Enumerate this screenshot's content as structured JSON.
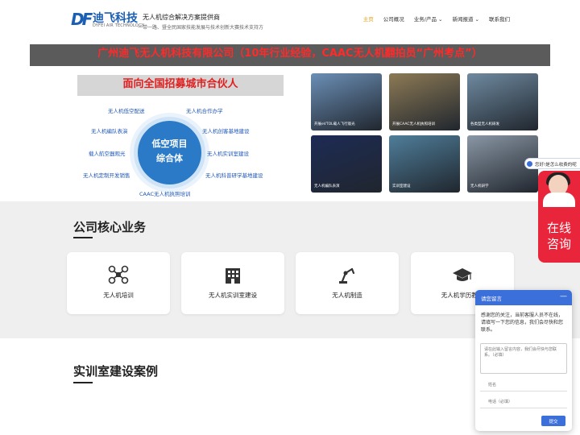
{
  "header": {
    "logo_mark": "DF",
    "logo_text": "迪飞科技",
    "logo_sub": "DYFEI AIR TECHNOLOGY",
    "slogan_title": "无人机综合解决方案提供商",
    "slogan_sub": "一带一路、暨全民国家技能发展与技术创新大赛技术支持方",
    "nav": [
      "主页",
      "公司概况",
      "业务/产品 ⌄",
      "新闻报道 ⌄",
      "联系我们"
    ]
  },
  "banner": {
    "text": "广州迪飞无人机科技有限公司（10年行业经验，CAAC无人机翻拍员“广州考点”）"
  },
  "partner": {
    "heading": "面向全国招募城市合伙人",
    "center_line1": "低空项目",
    "center_line2": "综合体",
    "tags": [
      "无人机低空配送",
      "无人机合作办学",
      "无人机编队表演",
      "无人机创客基地建设",
      "载人航空器观光",
      "无人机实训室建设",
      "无人机定制开发销售",
      "无人机科普研学基地建设",
      "CAAC无人机执照培训"
    ]
  },
  "photos": [
    {
      "caption": "开展eVTOL载人飞行观光",
      "color": "#6b8fb6"
    },
    {
      "caption": "开展CAAC无人机执照培训",
      "color": "#8d7a55"
    },
    {
      "caption": "各类型无人机研发",
      "color": "#6f8aa0"
    },
    {
      "caption": "无人机编队表演",
      "color": "#1d2b55"
    },
    {
      "caption": "实训室建设",
      "color": "#4f7e9a"
    },
    {
      "caption": "无人机研学",
      "color": "#8a97a5"
    }
  ],
  "services": {
    "title": "公司核心业务",
    "cards": [
      {
        "label": "无人机培训",
        "icon": "drone-icon"
      },
      {
        "label": "无人机实训室建设",
        "icon": "building-icon"
      },
      {
        "label": "无人机制造",
        "icon": "robot-arm-icon"
      },
      {
        "label": "无人机学历教育",
        "icon": "graduation-cap-icon"
      }
    ]
  },
  "cases": {
    "title": "实训室建设案例"
  },
  "consult": {
    "head": "您好!是怎么收费的呢",
    "line1": "在线",
    "line2": "咨询"
  },
  "message": {
    "title": "请您留言",
    "minimize": "—",
    "intro": "感谢您的关注，当前客服人员不在线，请填写一下您的信息，我们会尽快和您联系。",
    "area_placeholder": "请在此输入留言内容，我们会尽快与您联系。（必填）",
    "name_placeholder": "姓名",
    "phone_placeholder": "电话（必填）",
    "submit": "提交"
  },
  "colors": {
    "brand": "#1a5fb4",
    "nav_active": "#e8a31b",
    "banner_text": "#ff2a2a",
    "consult": "#e8253a",
    "widget": "#3b6fd9"
  }
}
